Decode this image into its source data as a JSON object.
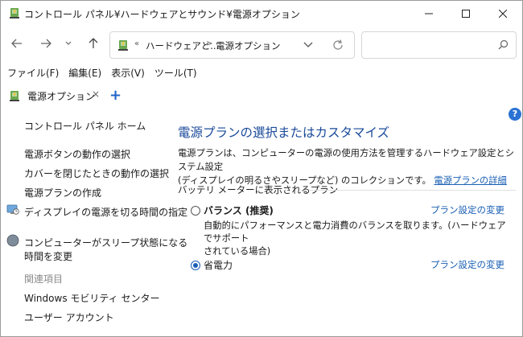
{
  "window": {
    "title": "コントロール パネル¥ハードウェアとサウンド¥電源オプション",
    "minimize_glyph": "—",
    "maximize_glyph": "☐",
    "close_glyph": "✕"
  },
  "address": {
    "overflow": "«",
    "crumbs": [
      "ハードウェアと...",
      "電源オプション"
    ],
    "separator": ">",
    "search_placeholder": ""
  },
  "menu": [
    "ファイル(F)",
    "編集(E)",
    "表示(V)",
    "ツール(T)"
  ],
  "tab": {
    "label": "電源オプション",
    "close": "×",
    "add": "+"
  },
  "help": "?",
  "sidebar": {
    "home": "コントロール パネル ホーム",
    "links": [
      "電源ボタンの動作の選択",
      "カバーを閉じたときの動作の選択",
      "電源プランの作成",
      "ディスプレイの電源を切る時間の指定",
      "コンピューターがスリープ状態になる",
      "時間を変更"
    ],
    "related_header": "関連項目",
    "related": [
      "Windows モビリティ センター",
      "ユーザー アカウント"
    ]
  },
  "main": {
    "heading": "電源プランの選択またはカスタマイズ",
    "desc_line1": "電源プランは、コンピューターの電源の使用方法を管理するハードウェア設定とシステム設定",
    "desc_line2": "(ディスプレイの明るさやスリープなど) のコレクションです。",
    "desc_link": "電源プランの詳細",
    "group_title": "バッテリ メーターに表示されるプラン",
    "plans": [
      {
        "name": "バランス (推奨)",
        "change": "プラン設定の変更",
        "desc1": "自動的にパフォーマンスと電力消費のバランスを取ります。(ハードウェアでサポート",
        "desc2": "されている場合)",
        "selected": false
      },
      {
        "name": "省電力",
        "change": "プラン設定の変更",
        "selected": true
      }
    ]
  },
  "colors": {
    "accent": "#1a5fb4",
    "heading": "#1a4a9a",
    "muted": "#8a8a8a"
  },
  "icons": [
    "control-panel-power-icon",
    "back-icon",
    "forward-icon",
    "recent-icon",
    "up-icon",
    "chevron-down-icon",
    "refresh-icon",
    "search-icon",
    "monitor-clock-icon",
    "sleep-moon-icon",
    "help-icon"
  ]
}
